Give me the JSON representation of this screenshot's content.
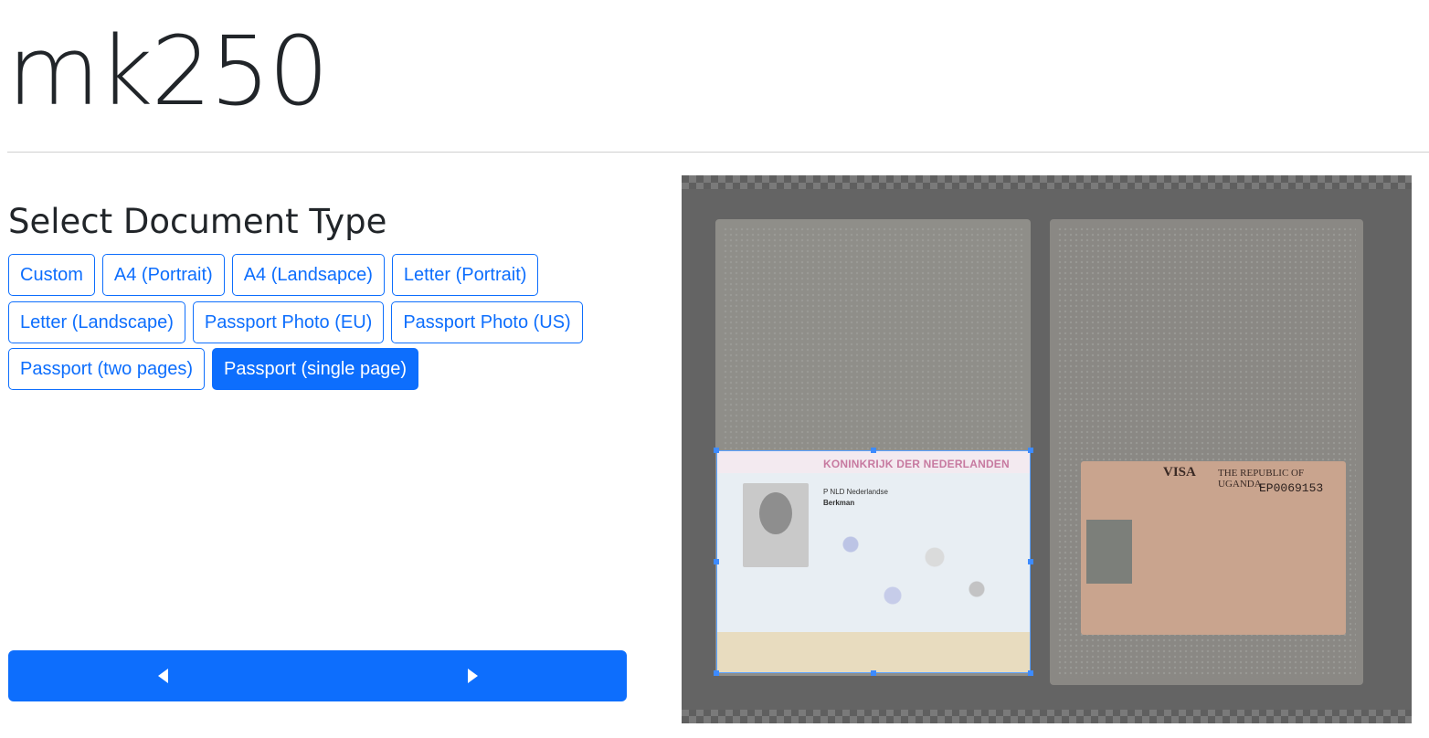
{
  "header": {
    "app_title": "mk250"
  },
  "document_type": {
    "section_title": "Select Document Type",
    "rows": [
      [
        {
          "label": "Custom",
          "active": false
        },
        {
          "label": "A4 (Portrait)",
          "active": false
        },
        {
          "label": "A4 (Landsapce)",
          "active": false
        },
        {
          "label": "Letter (Portrait)",
          "active": false
        }
      ],
      [
        {
          "label": "Letter (Landscape)",
          "active": false
        },
        {
          "label": "Passport Photo (EU)",
          "active": false
        },
        {
          "label": "Passport Photo (US)",
          "active": false
        }
      ],
      [
        {
          "label": "Passport (two pages)",
          "active": false
        },
        {
          "label": "Passport (single page)",
          "active": true
        }
      ]
    ]
  },
  "navigation": {
    "prev_icon": "triangle-left-icon",
    "next_icon": "triangle-right-icon"
  },
  "preview": {
    "data_page_title": "KONINKRIJK DER NEDERLANDEN",
    "data_page_nationality": "P   NLD Nederlandse",
    "data_page_surname": "Berkman",
    "visa_label": "VISA",
    "visa_country": "THE REPUBLIC OF UGANDA",
    "visa_number": "EP0069153"
  },
  "colors": {
    "accent": "#0d6efd",
    "text": "#212529",
    "crop_border": "#5aa2ff"
  }
}
